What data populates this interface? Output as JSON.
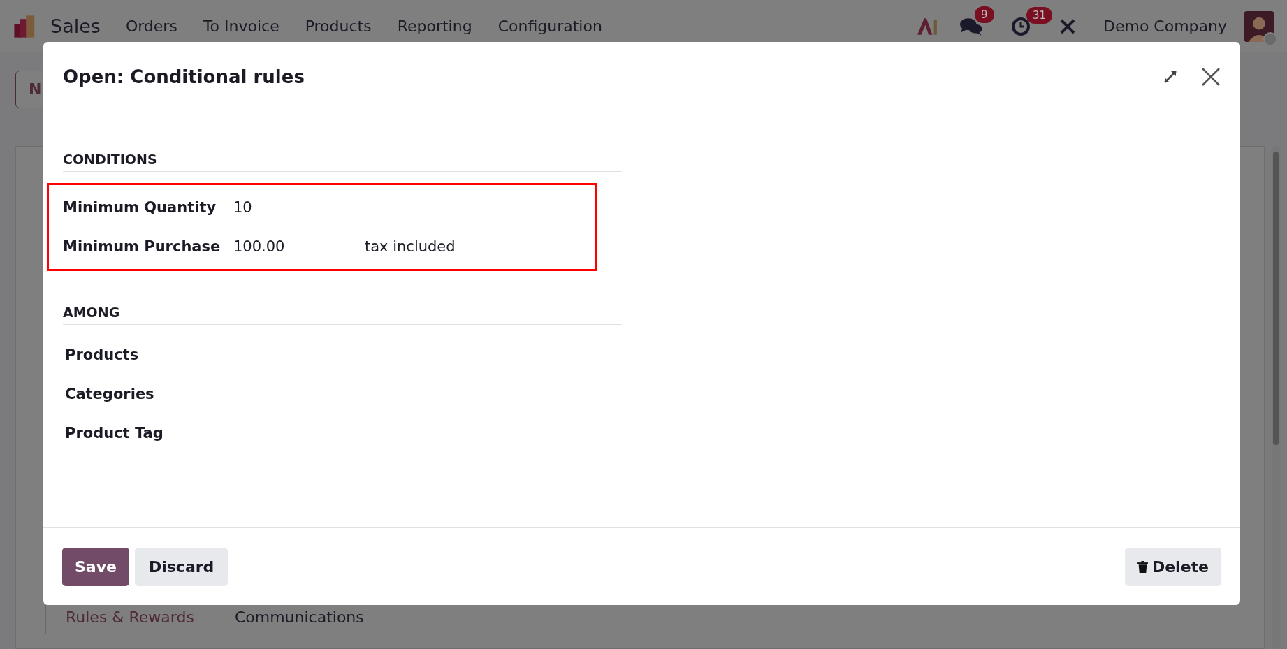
{
  "navbar": {
    "app_name": "Sales",
    "menu": [
      "Orders",
      "To Invoice",
      "Products",
      "Reporting",
      "Configuration"
    ],
    "messages_badge": "9",
    "activities_badge": "31",
    "company": "Demo Company"
  },
  "control_panel": {
    "button_fragment": "N"
  },
  "background_tabs": [
    {
      "label": "Rules & Rewards",
      "selected": true
    },
    {
      "label": "Communications",
      "selected": false
    }
  ],
  "dialog": {
    "title": "Open: Conditional rules",
    "sections": [
      {
        "heading": "CONDITIONS",
        "highlighted": true,
        "fields": [
          {
            "label": "Minimum Quantity",
            "value": "10"
          },
          {
            "label": "Minimum Purchase",
            "value": "100.00",
            "suffix": "tax included"
          }
        ]
      },
      {
        "heading": "AMONG",
        "highlighted": false,
        "fields": [
          {
            "label": "Products"
          },
          {
            "label": "Categories"
          },
          {
            "label": "Product Tag"
          }
        ]
      }
    ],
    "buttons": [
      {
        "label": "Save",
        "kind": "primary"
      },
      {
        "label": "Discard",
        "kind": "secondary"
      },
      {
        "label": "Delete",
        "kind": "delete"
      }
    ]
  }
}
